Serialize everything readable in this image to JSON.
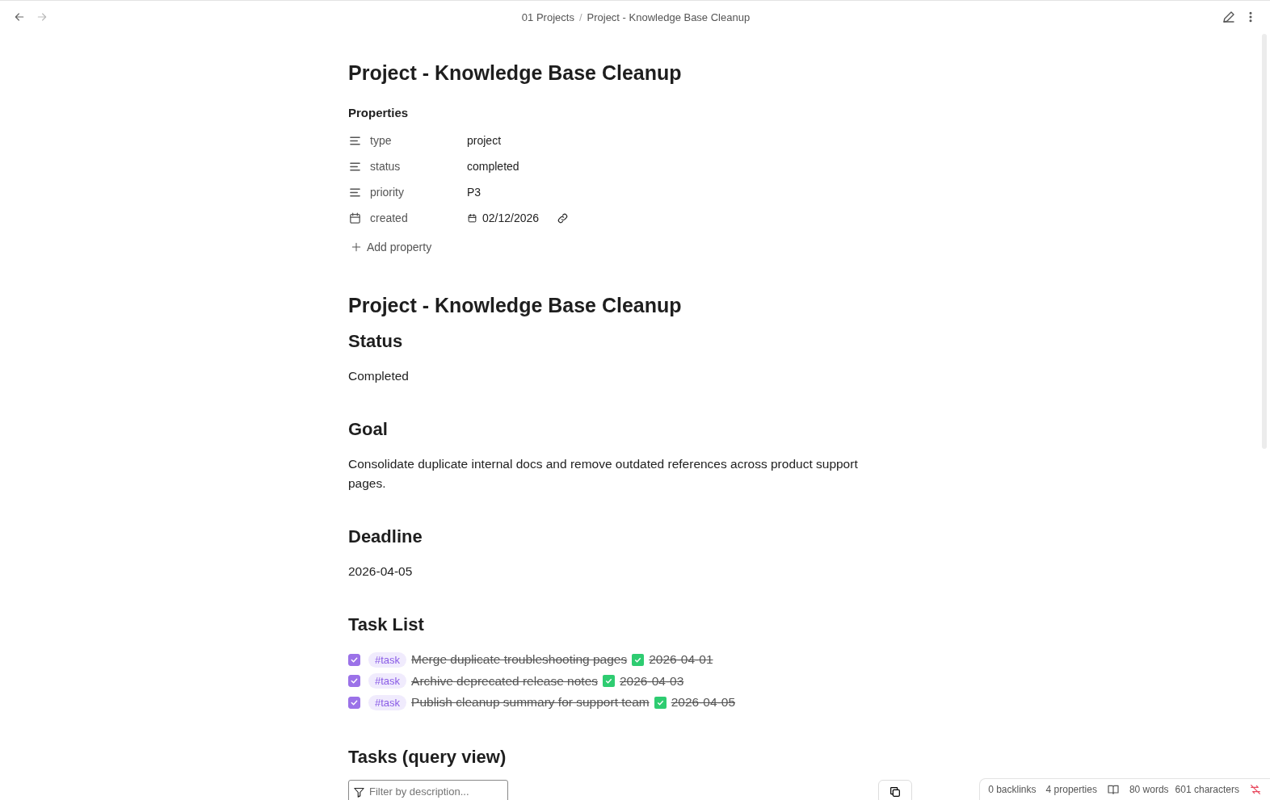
{
  "breadcrumb": [
    "01 Projects",
    "/",
    "Project - Knowledge Base Cleanup"
  ],
  "title": "Project - Knowledge Base Cleanup",
  "properties": {
    "heading": "Properties",
    "add_label": "Add property",
    "items": [
      {
        "kind": "text",
        "name": "type",
        "value": "project"
      },
      {
        "kind": "text",
        "name": "status",
        "value": "completed"
      },
      {
        "kind": "text",
        "name": "priority",
        "value": "P3"
      },
      {
        "kind": "date",
        "name": "created",
        "value": "02/12/2026"
      }
    ]
  },
  "body": [
    {
      "kind": "h1",
      "text": "Project - Knowledge Base Cleanup"
    },
    {
      "kind": "h2",
      "text": "Status"
    },
    {
      "kind": "p",
      "text": "Completed"
    },
    {
      "kind": "h2",
      "text": "Goal"
    },
    {
      "kind": "p",
      "text": "Consolidate duplicate internal docs and remove outdated references across product support pages."
    },
    {
      "kind": "h2",
      "text": "Deadline"
    },
    {
      "kind": "p",
      "text": "2026-04-05"
    },
    {
      "kind": "h2",
      "text": "Task List"
    },
    {
      "kind": "tasks",
      "items": [
        {
          "checked": true,
          "tag": "#task",
          "text": "Merge duplicate troubleshooting pages",
          "date": "2026-04-01"
        },
        {
          "checked": true,
          "tag": "#task",
          "text": "Archive deprecated release notes",
          "date": "2026-04-03"
        },
        {
          "checked": true,
          "tag": "#task",
          "text": "Publish cleanup summary for support team",
          "date": "2026-04-05"
        }
      ]
    },
    {
      "kind": "h2",
      "text": "Tasks (query view)"
    },
    {
      "kind": "filter",
      "placeholder": "Filter by description..."
    }
  ],
  "status_bar": {
    "backlinks": "0 backlinks",
    "properties": "4 properties",
    "words": "80 words",
    "characters": "601 characters"
  }
}
